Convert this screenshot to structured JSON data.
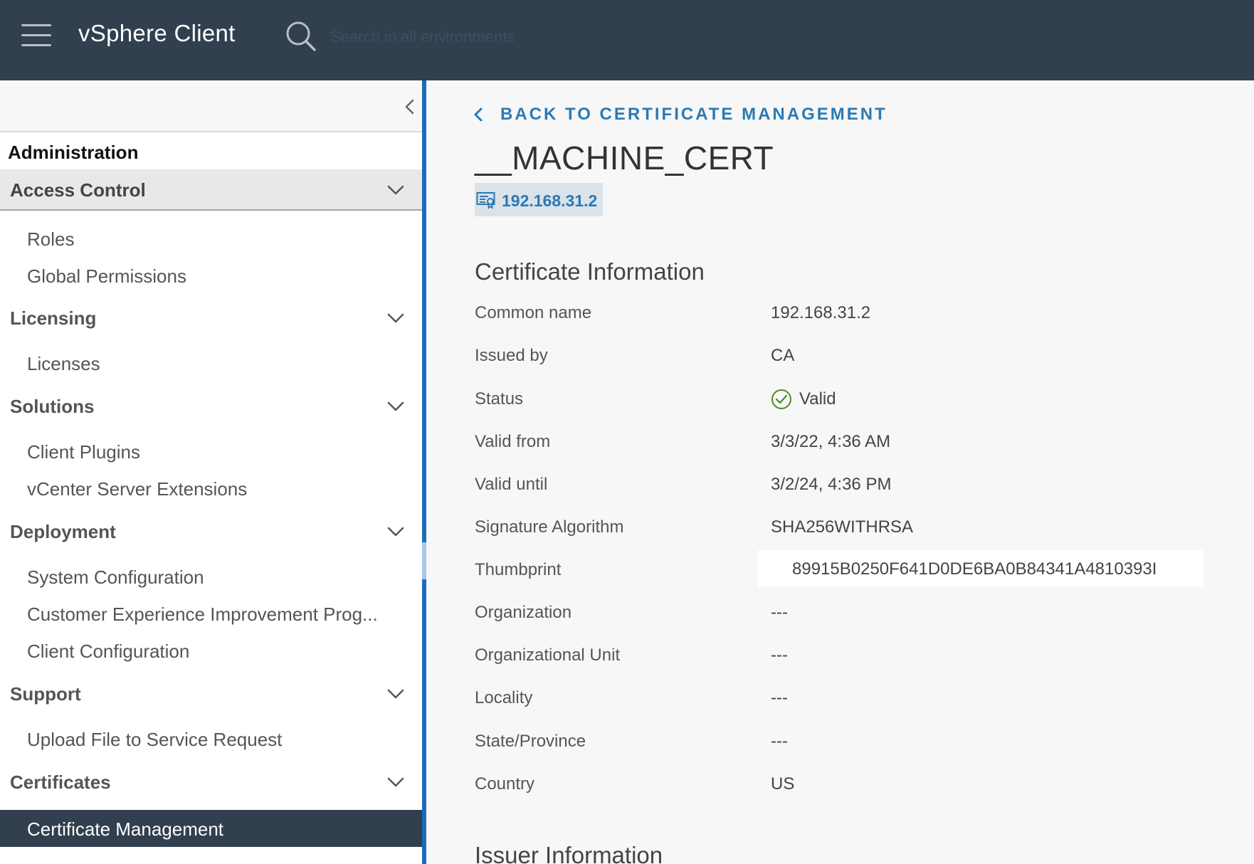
{
  "header": {
    "app_title": "vSphere Client",
    "search_placeholder": "Search in all environments",
    "icons": [
      "hamburger-menu-icon",
      "search-icon"
    ]
  },
  "sidebar": {
    "title": "Administration",
    "sections": [
      {
        "label": "Access Control",
        "active": true,
        "items": [
          "Roles",
          "Global Permissions"
        ]
      },
      {
        "label": "Licensing",
        "items": [
          "Licenses"
        ]
      },
      {
        "label": "Solutions",
        "items": [
          "Client Plugins",
          "vCenter Server Extensions"
        ]
      },
      {
        "label": "Deployment",
        "items": [
          "System Configuration",
          "Customer Experience Improvement Prog...",
          "Client Configuration"
        ]
      },
      {
        "label": "Support",
        "items": [
          "Upload File to Service Request"
        ]
      },
      {
        "label": "Certificates",
        "items": [
          "Certificate Management"
        ]
      }
    ],
    "selected_item": "Certificate Management"
  },
  "main": {
    "back_link": "BACK TO CERTIFICATE MANAGEMENT",
    "cert_title": "__MACHINE_CERT",
    "host": "192.168.31.2",
    "certificate_information": {
      "title": "Certificate Information",
      "rows": [
        {
          "label": "Common name",
          "value": "192.168.31.2"
        },
        {
          "label": "Issued by",
          "value": "CA"
        },
        {
          "label": "Status",
          "value": "Valid"
        },
        {
          "label": "Valid from",
          "value": "3/3/22, 4:36 AM"
        },
        {
          "label": "Valid until",
          "value": "3/2/24, 4:36 PM"
        },
        {
          "label": "Signature Algorithm",
          "value": "SHA256WITHRSA"
        },
        {
          "label": "Thumbprint",
          "value": "89915B0250F641D0DE6BA0B84341A4810393I"
        },
        {
          "label": "Organization",
          "value": "---"
        },
        {
          "label": "Organizational Unit",
          "value": "---"
        },
        {
          "label": "Locality",
          "value": "---"
        },
        {
          "label": "State/Province",
          "value": "---"
        },
        {
          "label": "Country",
          "value": "US"
        }
      ]
    },
    "issuer_information": {
      "title": "Issuer Information"
    }
  },
  "colors": {
    "header_bg": "#313f4f",
    "accent": "#2a7ab3",
    "divider": "#1b6dbb",
    "valid_green": "#4c8b21",
    "selected_bg": "#313f4f"
  }
}
